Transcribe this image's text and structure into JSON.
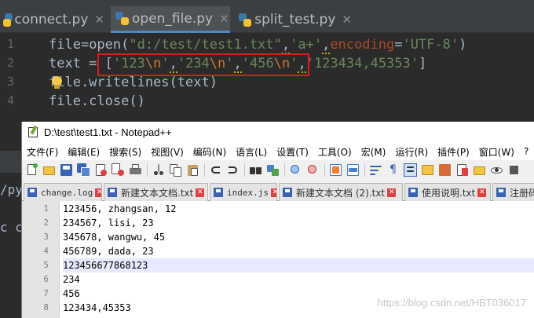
{
  "ide": {
    "tabs": [
      {
        "label": "connect.py"
      },
      {
        "label": "open_file.py"
      },
      {
        "label": "split_test.py"
      }
    ],
    "gutter": [
      "1",
      "2",
      "3",
      "4"
    ],
    "side_texts": [
      "/py",
      "c co"
    ]
  },
  "notepad": {
    "title": "D:\\test\\test1.txt - Notepad++",
    "menu": [
      "文件(F)",
      "编辑(E)",
      "搜索(S)",
      "视图(V)",
      "编码(N)",
      "语言(L)",
      "设置(T)",
      "工具(O)",
      "宏(M)",
      "运行(R)",
      "插件(P)",
      "窗口(W)",
      "?"
    ],
    "tabs": [
      {
        "label": "change.log"
      },
      {
        "label": "新建文本文档.txt"
      },
      {
        "label": "index.js"
      },
      {
        "label": "新建文本文档 (2).txt"
      },
      {
        "label": "使用说明.txt"
      },
      {
        "label": "注册码"
      }
    ],
    "lines": [
      {
        "num": "1",
        "text": "123456, zhangsan, 12"
      },
      {
        "num": "2",
        "text": "234567, lisi, 23"
      },
      {
        "num": "3",
        "text": "345678, wangwu, 45"
      },
      {
        "num": "4",
        "text": "456789, dada, 23"
      },
      {
        "num": "5",
        "text": "123456677868123"
      },
      {
        "num": "6",
        "text": "234"
      },
      {
        "num": "7",
        "text": "456"
      },
      {
        "num": "8",
        "text": "123434,45353"
      }
    ]
  },
  "watermark": "https://blog.csdn.net/HBT036017"
}
